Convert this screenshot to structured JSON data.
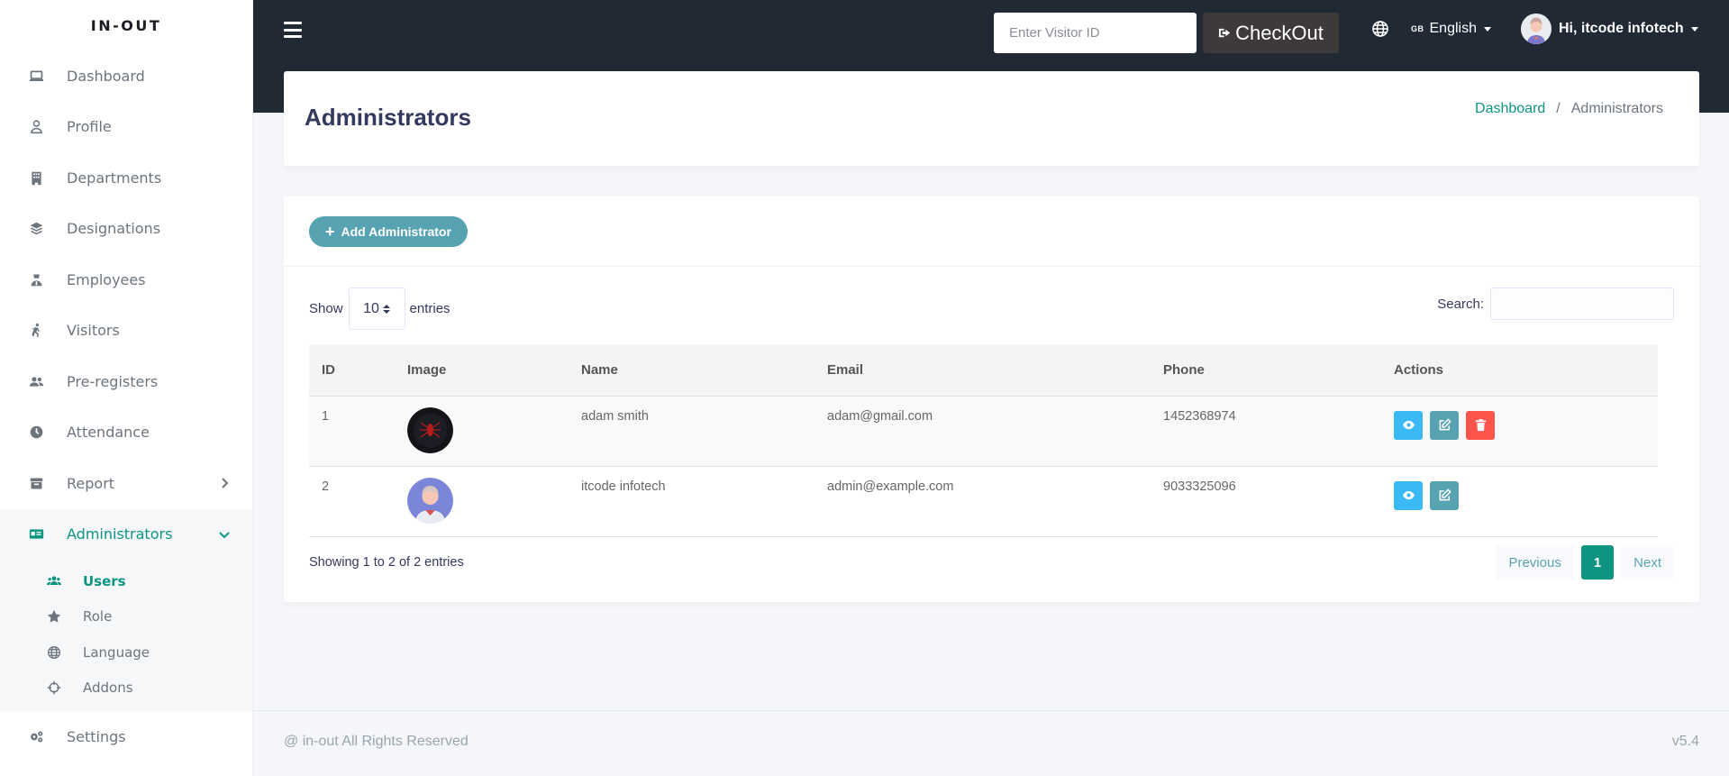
{
  "brand": "IN-OUT",
  "sidebar": {
    "items": [
      {
        "label": "Dashboard",
        "icon": "laptop-icon"
      },
      {
        "label": "Profile",
        "icon": "user-icon"
      },
      {
        "label": "Departments",
        "icon": "building-icon"
      },
      {
        "label": "Designations",
        "icon": "layers-icon"
      },
      {
        "label": "Employees",
        "icon": "user-tie-icon"
      },
      {
        "label": "Visitors",
        "icon": "walking-icon"
      },
      {
        "label": "Pre-registers",
        "icon": "users-icon"
      },
      {
        "label": "Attendance",
        "icon": "clock-icon"
      },
      {
        "label": "Report",
        "icon": "archive-icon"
      },
      {
        "label": "Administrators",
        "icon": "id-card-icon"
      }
    ],
    "subitems": [
      {
        "label": "Users",
        "icon": "users-icon"
      },
      {
        "label": "Role",
        "icon": "star-icon"
      },
      {
        "label": "Language",
        "icon": "globe-icon"
      },
      {
        "label": "Addons",
        "icon": "crosshairs-icon"
      }
    ],
    "settings": {
      "label": "Settings",
      "icon": "cogs-icon"
    }
  },
  "topbar": {
    "visitor_placeholder": "Enter Visitor ID",
    "checkout_label": "CheckOut",
    "lang_flag": "GB",
    "lang_label": "English",
    "user_label": "Hi, itcode infotech"
  },
  "header": {
    "title": "Administrators",
    "breadcrumb": [
      "Dashboard",
      "Administrators"
    ]
  },
  "main": {
    "add_label": "Add Administrator",
    "show_label": "Show",
    "entries_value": "10",
    "entries_label": "entries",
    "search_label": "Search:",
    "columns": [
      "ID",
      "Image",
      "Name",
      "Email",
      "Phone",
      "Actions"
    ],
    "rows": [
      {
        "id": "1",
        "name": "adam smith",
        "email": "adam@gmail.com",
        "phone": "1452368974"
      },
      {
        "id": "2",
        "name": "itcode infotech",
        "email": "admin@example.com",
        "phone": "9033325096"
      }
    ],
    "info": "Showing 1 to 2 of 2 entries",
    "pager": {
      "prev": "Previous",
      "page": "1",
      "next": "Next"
    }
  },
  "footer": {
    "copyright": "@ in-out All Rights Reserved",
    "version": "v5.4"
  },
  "colors": {
    "accent": "#0e9582",
    "topbar": "#212935",
    "button_teal": "#58a3b1",
    "view": "#3abaf4",
    "delete": "#fc544b"
  }
}
